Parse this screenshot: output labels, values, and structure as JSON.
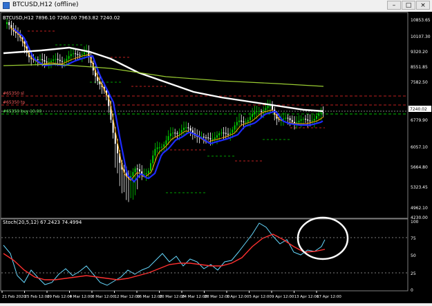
{
  "window": {
    "title": "BTCUSD,H12 (offline)",
    "min_label": "–",
    "max_label": "□",
    "close_label": "×"
  },
  "main_chart": {
    "symbol_line": "BTCUSD,H12  7896.10 7260.00 7963.82 7240.02",
    "y_labels": [
      "10853.65",
      "10107.30",
      "9320.20",
      "8551.85",
      "7582.50",
      "7240.02",
      "6779.90",
      "6057.10",
      "5664.80",
      "5323.45",
      "4962.10",
      "4230.00"
    ],
    "current_price": "7240.02",
    "order_labels": [
      "#65350 sl",
      "#65350 tp",
      "#65350 buy 10.00"
    ],
    "colors": {
      "up": "#00d000",
      "down": "#ffffff",
      "ma_fast": "#ffa500",
      "ma_mid": "#1e2bff",
      "ma_slow": "#ffffff",
      "ma_long": "#9acd32",
      "grid": "#5a6b5a",
      "level_red": "#c02020",
      "level_green": "#00c000"
    }
  },
  "stochastic": {
    "label": "Stoch(20,5,12) 67.2423 74.4994",
    "y_labels": [
      "100",
      "75",
      "50",
      "25",
      "0"
    ],
    "colors": {
      "main": "#66d9ff",
      "signal": "#ff3030"
    }
  },
  "x_labels": [
    "21 Feb 2020",
    "25 Feb 12:00",
    "29 Feb 12:00",
    "4 Mar 12:00",
    "8 Mar 12:00",
    "12 Mar 12:00",
    "16 Mar 12:00",
    "20 Mar 12:00",
    "24 Mar 12:00",
    "28 Mar 12:00",
    "1 Apr 12:00",
    "5 Apr 12:00",
    "9 Apr 12:00",
    "13 Apr 12:00",
    "17 Apr 12:00"
  ]
}
